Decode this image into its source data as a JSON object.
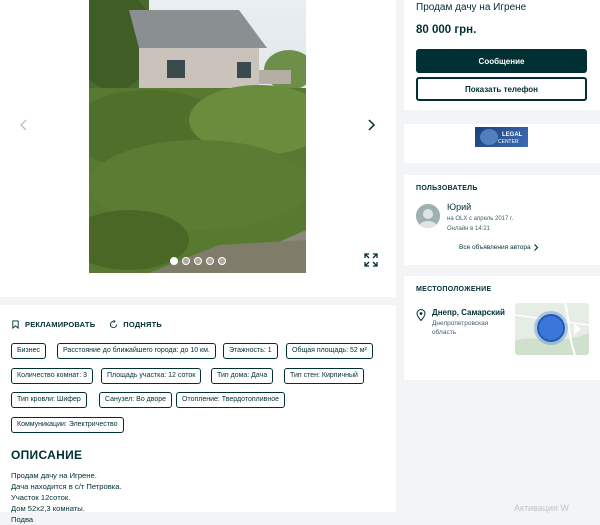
{
  "gallery": {
    "photo_alt": "",
    "dots_count": 5,
    "active_dot": 0
  },
  "actions": {
    "promote_label": "РЕКЛАМИРОВАТЬ",
    "raise_label": "ПОДНЯТЬ"
  },
  "tags": [
    "Бизнес",
    "Расстояние до ближайшего города: до 10 км.",
    "Этажность: 1",
    "Общая площадь: 52 м²",
    "Количество комнат: 3",
    "Площадь участка: 12 соток",
    "Тип дома: Дача",
    "Тип стен: Кирпичный",
    "Тип кровли: Шифер",
    "Санузел: Во дворе",
    "Отопление: Твердотопливное",
    "Коммуникации: Электричество"
  ],
  "description": {
    "title": "ОПИСАНИЕ",
    "lines": [
      "Продам дачу на Игрене.",
      "Дача находится в с/т Петровка.",
      "Участок 12соток.",
      "Дом 52х2,3 комнаты.",
      "Подва"
    ]
  },
  "ad": {
    "title": "Продам дачу на Игрене",
    "price": "80 000 грн.",
    "message_button": "Сообщение",
    "phone_button": "Показать телефон"
  },
  "logo": {
    "text": "LEGAL CENTER"
  },
  "user": {
    "section_label": "ПОЛЬЗОВАТЕЛЬ",
    "name": "Юрий",
    "since": "на OLX с апрель 2017 г.",
    "online": "Онлайн в 14:21",
    "all_ads": "Все объявления автора"
  },
  "location": {
    "section_label": "МЕСТОПОЛОЖЕНИЕ",
    "city": "Днепр, Самарский",
    "region": "Днепропетровская область"
  },
  "watermark": "Активация W",
  "colors": {
    "primary": "#002f34",
    "background": "#f2f4f5",
    "card": "#ffffff",
    "map_circle": "#3a77d6"
  }
}
